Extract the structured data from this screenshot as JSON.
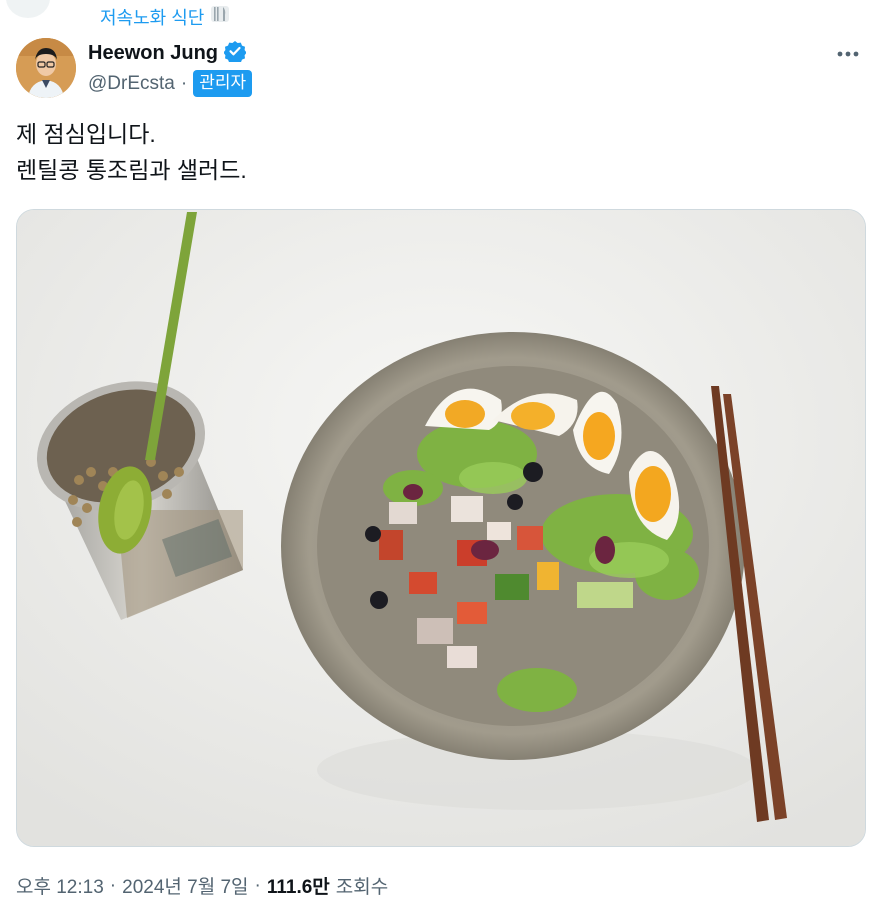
{
  "community": {
    "label": "저속노화 식단"
  },
  "author": {
    "display_name": "Heewon Jung",
    "handle": "@DrEcsta",
    "separator": "·",
    "role_badge": "관리자",
    "verified_color": "#1d9bf0"
  },
  "tweet": {
    "text": "제 점심입니다.\n렌틸콩 통조림과 샐러드."
  },
  "meta": {
    "time": "오후 12:13",
    "sep1": "·",
    "date": "2024년 7월 7일",
    "sep2": "·",
    "views": "111.6만",
    "views_label": "조회수"
  },
  "colors": {
    "accent": "#1d9bf0",
    "text": "#0f1419",
    "secondary": "#536471"
  },
  "icons": {
    "community": "fork-knife-plate-icon",
    "verified": "verified-badge-icon",
    "more": "more-horizontal-icon"
  }
}
